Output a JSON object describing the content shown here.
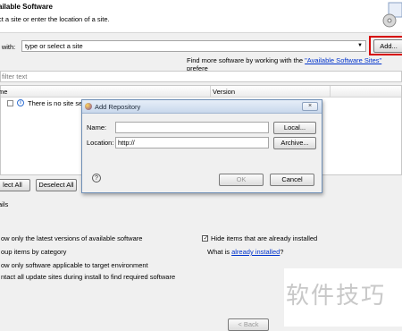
{
  "header": {
    "title": "ailable Software",
    "subtitle": "ct a site or enter the location of a site."
  },
  "work_with": {
    "label": "k with:",
    "value": "type or select a site",
    "add_label": "Add..."
  },
  "more_software": {
    "prefix": "Find more software by working with the ",
    "link": "\"Available Software Sites\"",
    "suffix": " prefere"
  },
  "filter": {
    "placeholder": "filter text"
  },
  "table": {
    "columns": [
      "me",
      "Version"
    ],
    "row_text": "There is no site selected"
  },
  "buttons": {
    "select_all": "lect All",
    "deselect_all": "Deselect All",
    "back": "< Back"
  },
  "details": {
    "label": "ails"
  },
  "options": {
    "latest": "ow only the latest versions of available software",
    "group": "oup items by category",
    "target": "ow only software applicable to target environment",
    "contact": "ntact all update sites during install to find required software",
    "hide": "Hide items that are already installed",
    "what_prefix": "What is ",
    "what_link": "already installed",
    "what_suffix": "?"
  },
  "dialog": {
    "title": "Add Repository",
    "close_label": "×",
    "name_label": "Name:",
    "name_value": "",
    "local_label": "Local...",
    "location_label": "Location:",
    "location_value": "http://",
    "archive_label": "Archive...",
    "help_label": "?",
    "ok_label": "OK",
    "cancel_label": "Cancel"
  },
  "watermark": {
    "text": "软件技巧"
  },
  "colors": {
    "accent_link": "#0033cc",
    "highlight": "#d60000"
  }
}
